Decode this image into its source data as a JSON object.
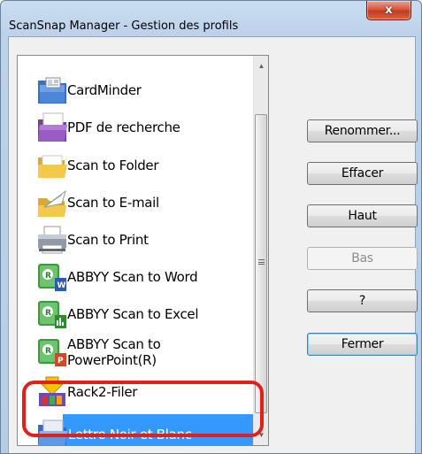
{
  "window": {
    "title": "ScanSnap Manager - Gestion des profils",
    "close_label": "x"
  },
  "profiles": {
    "items": [
      {
        "label": "CardMinder",
        "icon": "cardminder-icon"
      },
      {
        "label": "PDF de recherche",
        "icon": "pdf-folder-icon"
      },
      {
        "label": "Scan to Folder",
        "icon": "folder-icon"
      },
      {
        "label": "Scan to E-mail",
        "icon": "email-icon"
      },
      {
        "label": "Scan to Print",
        "icon": "printer-icon"
      },
      {
        "label": "ABBYY Scan to Word",
        "icon": "abbyy-word-icon"
      },
      {
        "label": "ABBYY Scan to Excel",
        "icon": "abbyy-excel-icon"
      },
      {
        "label_line1": "ABBYY Scan to",
        "label_line2": "PowerPoint(R)",
        "icon": "abbyy-powerpoint-icon"
      },
      {
        "label": "Rack2-Filer",
        "icon": "rack2-filer-icon"
      },
      {
        "label": "Lettre Noir et Blanc",
        "icon": "blue-folder-icon",
        "selected": true
      }
    ]
  },
  "buttons": {
    "rename": "Renommer...",
    "delete": "Effacer",
    "up": "Haut",
    "down": "Bas",
    "help": "?",
    "close": "Fermer"
  },
  "colors": {
    "selection": "#3399ff",
    "highlight_ring": "#e0201b"
  }
}
